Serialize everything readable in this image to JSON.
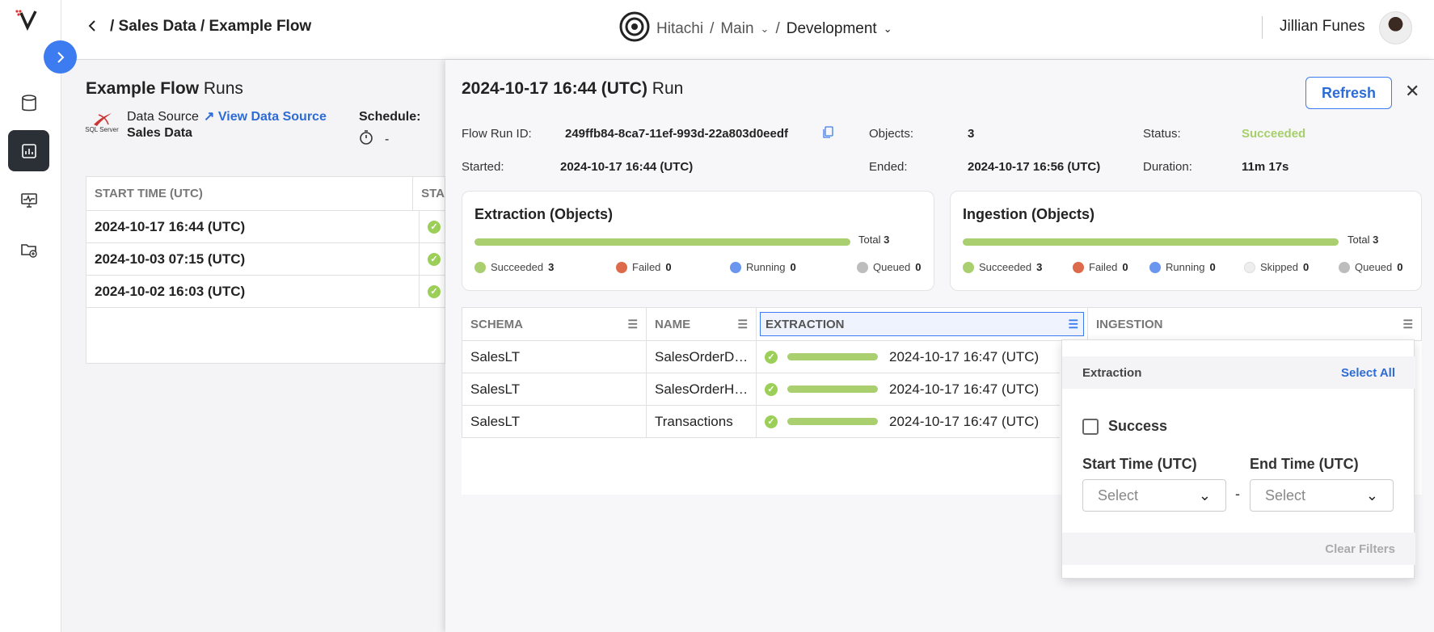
{
  "header": {
    "breadcrumb": "/ Sales Data / Example Flow",
    "org": "Hitachi",
    "separator": "/",
    "branch": "Main",
    "environment": "Development",
    "user_name": "Jillian Funes"
  },
  "left": {
    "flow_name": "Example Flow",
    "runs_suffix": "Runs",
    "data_source_label": "Data Source",
    "view_data_source": "View Data Source",
    "data_source_name": "Sales Data",
    "sql_label": "SQL Server",
    "schedule_label": "Schedule:",
    "schedule_value": "-",
    "table_headers": [
      "START TIME (UTC)",
      "STA"
    ],
    "rows": [
      {
        "start": "2024-10-17 16:44 (UTC)"
      },
      {
        "start": "2024-10-03 07:15 (UTC)"
      },
      {
        "start": "2024-10-02 16:03 (UTC)"
      }
    ]
  },
  "run": {
    "title_time": "2024-10-17 16:44 (UTC)",
    "title_suffix": "Run",
    "refresh": "Refresh",
    "flow_run_id_label": "Flow Run ID:",
    "flow_run_id": "249ffb84-8ca7-11ef-993d-22a803d0eedf",
    "objects_label": "Objects:",
    "objects": "3",
    "status_label": "Status:",
    "status": "Succeeded",
    "status_color": "#a6cf6a",
    "started_label": "Started:",
    "started": "2024-10-17 16:44 (UTC)",
    "ended_label": "Ended:",
    "ended": "2024-10-17 16:56 (UTC)",
    "duration_label": "Duration:",
    "duration": "11m 17s"
  },
  "extraction": {
    "title": "Extraction (Objects)",
    "total_label": "Total",
    "total": "3",
    "progress": 1.0,
    "legend": [
      {
        "label": "Succeeded",
        "count": "3",
        "color": "#a9cf6f"
      },
      {
        "label": "Failed",
        "count": "0",
        "color": "#dd6a4b"
      },
      {
        "label": "Running",
        "count": "0",
        "color": "#6a96f0"
      },
      {
        "label": "Queued",
        "count": "0",
        "color": "#bdbdbd"
      }
    ]
  },
  "ingestion": {
    "title": "Ingestion (Objects)",
    "total_label": "Total",
    "total": "3",
    "progress": 1.0,
    "legend": [
      {
        "label": "Succeeded",
        "count": "3",
        "color": "#a9cf6f"
      },
      {
        "label": "Failed",
        "count": "0",
        "color": "#dd6a4b"
      },
      {
        "label": "Running",
        "count": "0",
        "color": "#6a96f0"
      },
      {
        "label": "Skipped",
        "count": "0",
        "color": "#eeeeee"
      },
      {
        "label": "Queued",
        "count": "0",
        "color": "#bdbdbd"
      }
    ]
  },
  "objects_table": {
    "headers": [
      "SCHEMA",
      "NAME",
      "EXTRACTION",
      "INGESTION"
    ],
    "rows": [
      {
        "schema": "SalesLT",
        "name": "SalesOrderD…",
        "extraction_time": "2024-10-17 16:47 (UTC)"
      },
      {
        "schema": "SalesLT",
        "name": "SalesOrderH…",
        "extraction_time": "2024-10-17 16:47 (UTC)"
      },
      {
        "schema": "SalesLT",
        "name": "Transactions",
        "extraction_time": "2024-10-17 16:47 (UTC)"
      }
    ]
  },
  "filter": {
    "title": "Extraction",
    "select_all": "Select All",
    "option": "Success",
    "start_label": "Start Time (UTC)",
    "end_label": "End Time (UTC)",
    "start_placeholder": "Select",
    "end_placeholder": "Select",
    "dash": "-",
    "clear": "Clear Filters"
  }
}
